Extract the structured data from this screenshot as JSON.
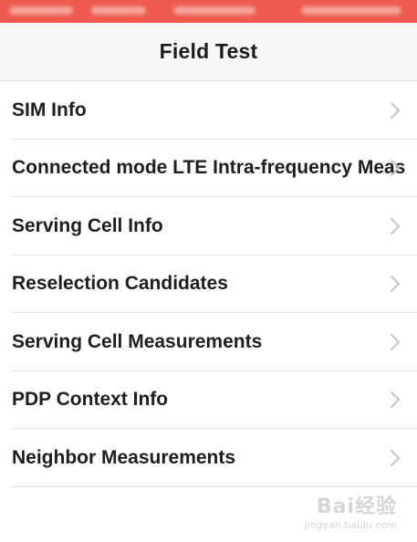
{
  "status_bar": {
    "color": "#ee5a4e"
  },
  "header": {
    "title": "Field Test"
  },
  "menu": {
    "items": [
      {
        "label": "SIM Info",
        "icon": "chevron-right-icon"
      },
      {
        "label": "Connected mode LTE Intra-frequency Meas",
        "icon": "chevron-right-icon"
      },
      {
        "label": "Serving Cell Info",
        "icon": "chevron-right-icon"
      },
      {
        "label": "Reselection Candidates",
        "icon": "chevron-right-icon"
      },
      {
        "label": "Serving Cell Measurements",
        "icon": "chevron-right-icon"
      },
      {
        "label": "PDP Context Info",
        "icon": "chevron-right-icon"
      },
      {
        "label": "Neighbor Measurements",
        "icon": "chevron-right-icon"
      }
    ]
  },
  "watermark": {
    "logo_text": "Bai经验",
    "url": "jingyan.baidu.com"
  }
}
